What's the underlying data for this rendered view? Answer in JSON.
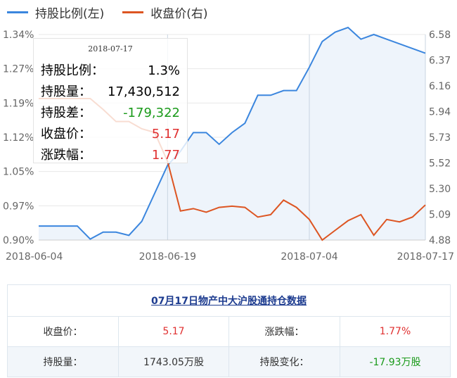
{
  "legend": [
    {
      "name": "持股比例(左)",
      "color": "#3b86de"
    },
    {
      "name": "收盘价(右)",
      "color": "#dd5522"
    }
  ],
  "chart_data": {
    "type": "line",
    "x": [
      "2018-06-04",
      "2018-06-05",
      "2018-06-06",
      "2018-06-07",
      "2018-06-08",
      "2018-06-11",
      "2018-06-12",
      "2018-06-13",
      "2018-06-14",
      "2018-06-15",
      "2018-06-19",
      "2018-06-20",
      "2018-06-21",
      "2018-06-22",
      "2018-06-25",
      "2018-06-26",
      "2018-06-27",
      "2018-06-28",
      "2018-06-29",
      "2018-07-02",
      "2018-07-03",
      "2018-07-04",
      "2018-07-05",
      "2018-07-06",
      "2018-07-09",
      "2018-07-10",
      "2018-07-11",
      "2018-07-12",
      "2018-07-13",
      "2018-07-16",
      "2018-07-17"
    ],
    "x_tick_labels": [
      "2018-06-04",
      "2018-06-19",
      "2018-07-04",
      "2018-07-17"
    ],
    "series": [
      {
        "name": "持股比例(左)",
        "axis": "left",
        "color": "#3b86de",
        "values": [
          0.93,
          0.93,
          0.93,
          0.93,
          0.902,
          0.917,
          0.917,
          0.91,
          0.94,
          1.0,
          1.06,
          1.09,
          1.13,
          1.13,
          1.105,
          1.13,
          1.15,
          1.21,
          1.21,
          1.22,
          1.22,
          1.27,
          1.325,
          1.345,
          1.355,
          1.33,
          1.34,
          1.33,
          1.32,
          1.31,
          1.3
        ]
      },
      {
        "name": "收盘价(右)",
        "axis": "right",
        "color": "#dd5522",
        "values": [
          6.05,
          6.05,
          6.05,
          6.05,
          6.05,
          5.96,
          5.86,
          5.86,
          5.8,
          5.77,
          5.53,
          5.12,
          5.14,
          5.11,
          5.15,
          5.16,
          5.15,
          5.07,
          5.09,
          5.21,
          5.15,
          5.05,
          4.88,
          4.96,
          5.04,
          5.09,
          4.92,
          5.05,
          5.03,
          5.07,
          5.17
        ]
      }
    ],
    "y_left": {
      "ticks": [
        "0.90%",
        "0.97%",
        "1.05%",
        "1.12%",
        "1.19%",
        "1.27%",
        "1.34%"
      ],
      "range": [
        0.9,
        1.34
      ]
    },
    "y_right": {
      "ticks": [
        "4.88",
        "5.09",
        "5.30",
        "5.52",
        "5.73",
        "5.94",
        "6.16",
        "6.37",
        "6.58"
      ],
      "range": [
        4.88,
        6.58
      ]
    },
    "grid": true,
    "area_fill": "#eef4fb",
    "legend_position": "top-left",
    "crosshair_date": "2018-07-17",
    "vertical_lines": [
      "2018-06-19",
      "2018-07-04"
    ]
  },
  "tooltip": {
    "date": "2018-07-17",
    "rows": [
      {
        "label": "持股比例：",
        "value": "1.3%",
        "color": "#000000"
      },
      {
        "label": "持股量：",
        "value": "17,430,512",
        "color": "#000000"
      },
      {
        "label": "持股差：",
        "value": "-179,322",
        "color": "#1a9a1a"
      },
      {
        "label": "收盘价：",
        "value": "5.17",
        "color": "#e03030"
      },
      {
        "label": "涨跌幅：",
        "value": "1.77",
        "color": "#e03030"
      }
    ]
  },
  "table": {
    "title": "07月17日物产中大沪股通持仓数据",
    "close_label": "收盘价：",
    "close_value": "5.17",
    "change_label": "涨跌幅：",
    "change_value": "1.77%",
    "hold_label": "持股量：",
    "hold_value": "1743.05万股",
    "diff_label": "持股变化：",
    "diff_value": "-17.93万股"
  }
}
